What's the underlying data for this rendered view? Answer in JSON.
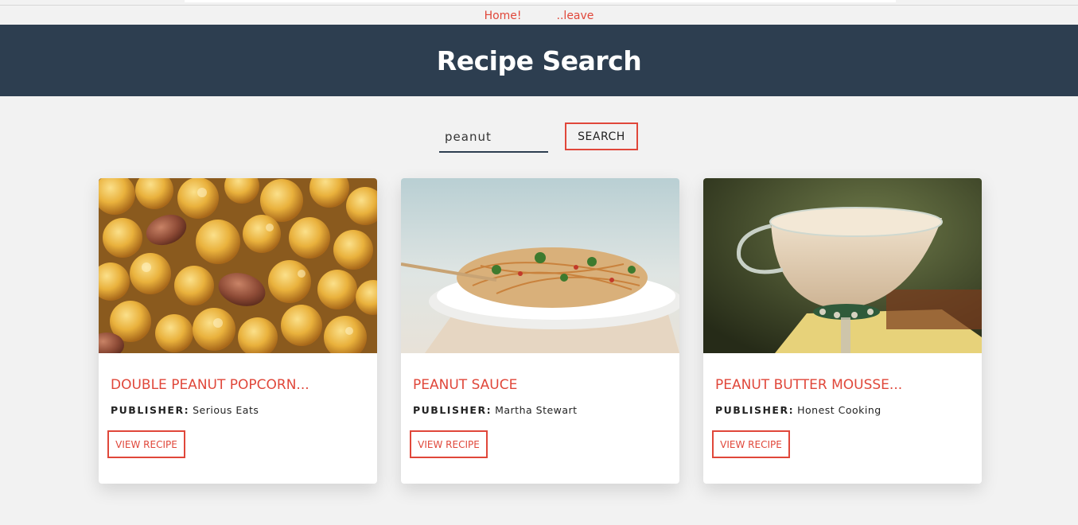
{
  "nav": {
    "home": "Home!",
    "leave": "..leave"
  },
  "header": {
    "title": "Recipe Search"
  },
  "search": {
    "value": "peanut",
    "button": "SEARCH"
  },
  "colors": {
    "accent": "#e0473a",
    "header_bg": "#2d3e50",
    "page_bg": "#f2f2f2"
  },
  "recipes": [
    {
      "title": "DOUBLE PEANUT POPCORN...",
      "publisher_label": "PUBLISHER:",
      "publisher": "Serious Eats",
      "button": "VIEW RECIPE",
      "image": "caramel popcorn with peanuts"
    },
    {
      "title": "PEANUT SAUCE",
      "publisher_label": "PUBLISHER:",
      "publisher": "Martha Stewart",
      "button": "VIEW RECIPE",
      "image": "noodle salad with peanut sauce"
    },
    {
      "title": "PEANUT BUTTER MOUSSE...",
      "publisher_label": "PUBLISHER:",
      "publisher": "Honest Cooking",
      "button": "VIEW RECIPE",
      "image": "mousse in a glass cup"
    }
  ]
}
